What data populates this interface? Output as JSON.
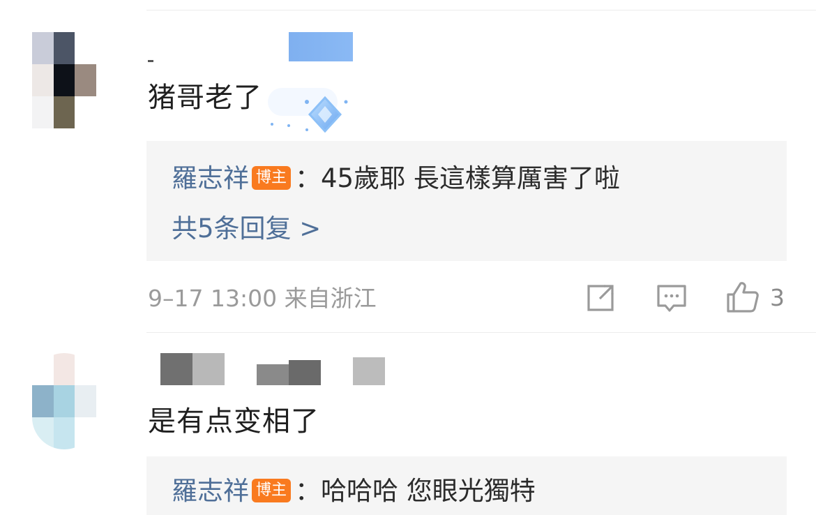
{
  "comments": [
    {
      "text": "猪哥老了",
      "reply": {
        "author": "羅志祥",
        "badge": "博主",
        "separator": "：",
        "text": "45歲耶 長這樣算厲害了啦"
      },
      "reply_count": "共5条回复 >",
      "meta": "9–17 13:00  来自浙江",
      "likes": "3"
    },
    {
      "text": "是有点变相了",
      "reply": {
        "author": "羅志祥",
        "badge": "博主",
        "separator": "：",
        "text": "哈哈哈 您眼光獨特"
      }
    }
  ],
  "icons": {
    "share": "share-icon",
    "comment": "comment-icon",
    "like": "thumbs-up-icon",
    "sticker": "diamond-sticker-icon"
  },
  "colors": {
    "reply_author": "#4f6f98",
    "badge": "#f97a1f",
    "meta": "#9a9a9a",
    "reply_bg": "#f5f5f5"
  }
}
